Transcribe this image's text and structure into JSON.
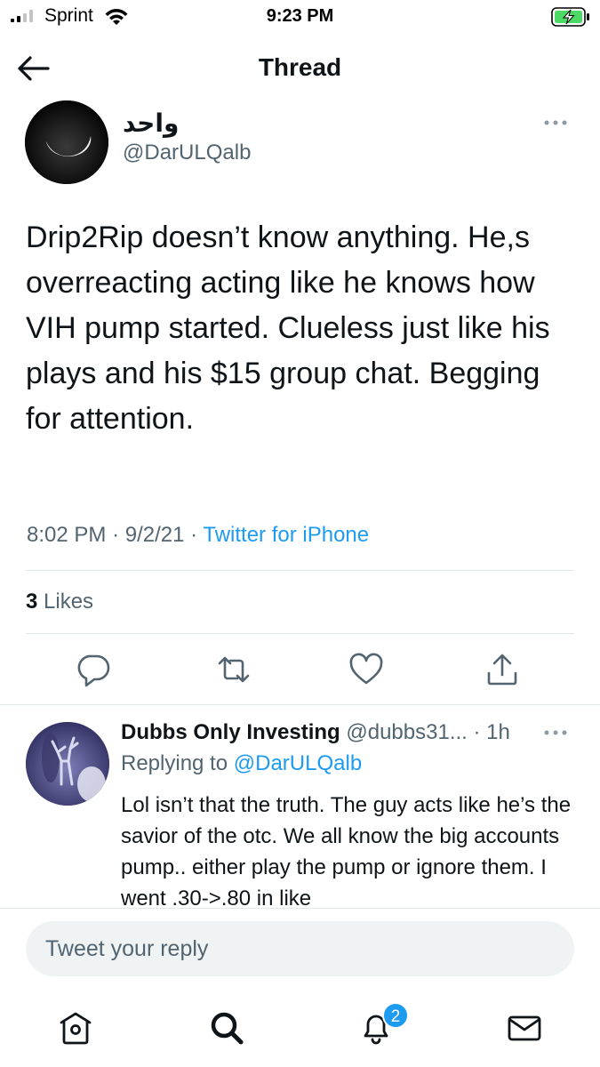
{
  "status_bar": {
    "carrier": "Sprint",
    "time": "9:23 PM",
    "signal_bars": 4,
    "signal_bars_active": 2
  },
  "header": {
    "title": "Thread",
    "back_icon": "arrow-left-icon"
  },
  "tweet": {
    "author_name": "واحد",
    "author_handle": "@DarULQalb",
    "text": "Drip2Rip doesn’t know anything. He,s overreacting acting like he knows how VIH pump started. Clueless just like his plays and his $15 group chat. Begging for attention.",
    "time": "8:02 PM",
    "date": "9/2/21",
    "source": "Twitter for iPhone",
    "likes_count": "3",
    "likes_label": "Likes",
    "actions": [
      "reply-icon",
      "retweet-icon",
      "like-icon",
      "share-icon"
    ]
  },
  "reply": {
    "author_name": "Dubbs Only Investing",
    "author_handle": "@dubbs31...",
    "age": "1h",
    "replying_label": "Replying to",
    "replying_to": "@DarULQalb",
    "text": "Lol isn’t that the truth. The guy acts like he’s the savior of the otc. We all know the big accounts pump.. either play the pump or ignore them. I went .30->.80 in like"
  },
  "compose": {
    "placeholder": "Tweet your reply"
  },
  "tabbar": {
    "items": [
      "home-icon",
      "search-icon",
      "notifications-icon",
      "messages-icon"
    ],
    "notifications_badge": "2"
  },
  "colors": {
    "accent": "#1d9bf0",
    "text": "#0f1419",
    "secondary": "#536471",
    "battery_fill": "#4cd964"
  }
}
